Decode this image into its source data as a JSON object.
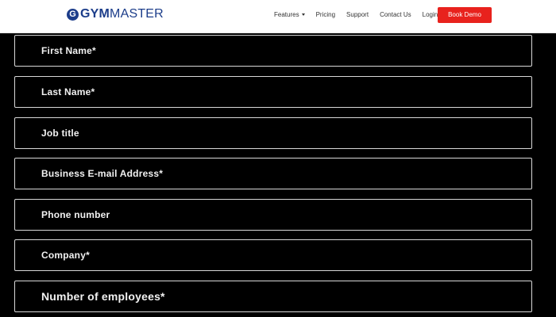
{
  "header": {
    "logo_prefix": "GYM",
    "logo_suffix": "MASTER",
    "logo_mark": "G",
    "nav": {
      "features": "Features",
      "pricing": "Pricing",
      "support": "Support",
      "contact": "Contact Us",
      "login": "Login"
    },
    "cta": "Book Demo"
  },
  "form": {
    "fields": [
      {
        "label": "First Name*"
      },
      {
        "label": "Last Name*"
      },
      {
        "label": "Job title"
      },
      {
        "label": "Business E-mail Address*"
      },
      {
        "label": "Phone number"
      },
      {
        "label": "Company*"
      },
      {
        "label": "Number of employees*"
      }
    ]
  },
  "colors": {
    "brand_blue": "#1c3d8a",
    "cta_red": "#e8221d",
    "page_background": "#000000",
    "field_border": "#d8d8d8"
  }
}
